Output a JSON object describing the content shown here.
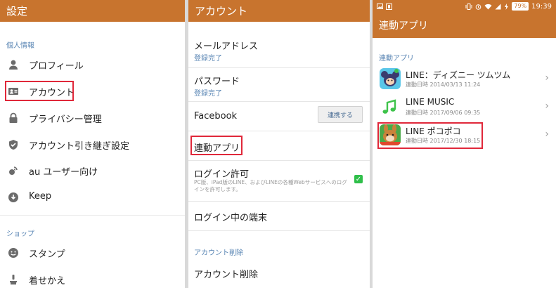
{
  "panel1": {
    "header_title": "設定",
    "section_personal": "個人情報",
    "items": [
      {
        "label": "プロフィール",
        "icon": "person-icon"
      },
      {
        "label": "アカウント",
        "icon": "id-card-icon"
      },
      {
        "label": "プライバシー管理",
        "icon": "lock-icon"
      },
      {
        "label": "アカウント引き継ぎ設定",
        "icon": "shield-check-icon"
      },
      {
        "label": "au ユーザー向け",
        "icon": "au-icon"
      },
      {
        "label": "Keep",
        "icon": "keep-download-icon"
      }
    ],
    "section_shop": "ショップ",
    "shop_items": [
      {
        "label": "スタンプ",
        "icon": "smiley-icon"
      },
      {
        "label": "着せかえ",
        "icon": "brush-icon"
      }
    ]
  },
  "panel2": {
    "header_title": "アカウント",
    "email_title": "メールアドレス",
    "email_status": "登録完了",
    "password_title": "パスワード",
    "password_status": "登録完了",
    "facebook_title": "Facebook",
    "facebook_button": "連携する",
    "linked_apps_title": "連動アプリ",
    "login_permission_title": "ログイン許可",
    "login_permission_desc": "PC版、iPad版のLINE、およびLINEの各種Webサービスへのログインを許可します。",
    "login_permission_checked": true,
    "logged_in_devices_title": "ログイン中の端末",
    "delete_section": "アカウント削除",
    "delete_title": "アカウント削除"
  },
  "panel3": {
    "status_battery": "79%",
    "status_time": "19:39",
    "header_title": "連動アプリ",
    "section_label": "連動アプリ",
    "apps": [
      {
        "name": "LINE：ディズニー ツムツム",
        "date": "連動日時 2014/03/13 11:24",
        "icon": "tsum-tsum-app-icon"
      },
      {
        "name": "LINE MUSIC",
        "date": "連動日時 2017/09/06 09:35",
        "icon": "music-note-icon"
      },
      {
        "name": "LINE ポコポコ",
        "date": "連動日時 2017/12/30 18:15",
        "icon": "pokopoko-app-icon"
      }
    ]
  },
  "colors": {
    "header": "#c8742e",
    "section_label": "#5a86b4",
    "highlight": "#e0283a",
    "check": "#2fbf4a"
  }
}
